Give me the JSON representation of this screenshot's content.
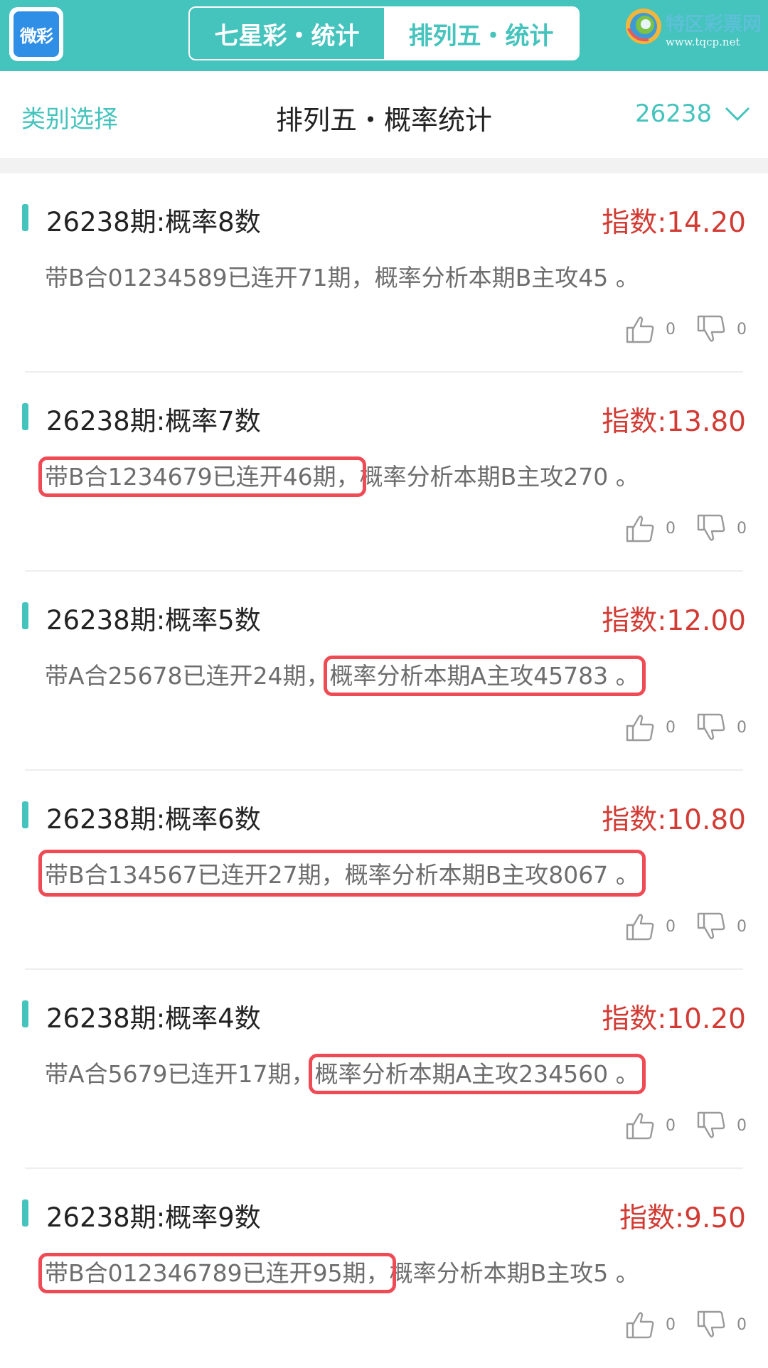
{
  "header": {
    "logo_text": "微彩",
    "tabs": [
      {
        "label": "七星彩・统计",
        "active": false
      },
      {
        "label": "排列五・统计",
        "active": true
      }
    ],
    "brand": {
      "name": "特区彩票网",
      "url": "www.tqcp.net"
    }
  },
  "subheader": {
    "category_label": "类别选择",
    "title": "排列五・概率统计",
    "issue": "26238"
  },
  "colors": {
    "accent": "#45c3bd",
    "index_red": "#d23b34",
    "highlight": "#ee4b55"
  },
  "cards": [
    {
      "title": "26238期:概率8数",
      "index": "指数:14.20",
      "desc_a": "带B合01234589已连开71期，",
      "desc_b": "概率分析本期B主攻45 。",
      "highlight": "none",
      "likes": "0",
      "dislikes": "0"
    },
    {
      "title": "26238期:概率7数",
      "index": "指数:13.80",
      "desc_a": "带B合1234679已连开46期，",
      "desc_b": "概率分析本期B主攻270 。",
      "highlight": "a",
      "likes": "0",
      "dislikes": "0"
    },
    {
      "title": "26238期:概率5数",
      "index": "指数:12.00",
      "desc_a": "带A合25678已连开24期，",
      "desc_b": "概率分析本期A主攻45783 。",
      "highlight": "b",
      "likes": "0",
      "dislikes": "0"
    },
    {
      "title": "26238期:概率6数",
      "index": "指数:10.80",
      "desc_a": "带B合134567已连开27期，",
      "desc_b": "概率分析本期B主攻8067 。",
      "highlight": "all",
      "likes": "0",
      "dislikes": "0"
    },
    {
      "title": "26238期:概率4数",
      "index": "指数:10.20",
      "desc_a": "带A合5679已连开17期，",
      "desc_b": "概率分析本期A主攻234560 。",
      "highlight": "b",
      "likes": "0",
      "dislikes": "0"
    },
    {
      "title": "26238期:概率9数",
      "index": "指数:9.50",
      "desc_a": "带B合012346789已连开95期，",
      "desc_b": "概率分析本期B主攻5 。",
      "highlight": "a",
      "likes": "0",
      "dislikes": "0"
    }
  ],
  "icons": {
    "like": "thumbs-up-icon",
    "dislike": "thumbs-down-icon",
    "dropdown": "chevron-down-icon"
  }
}
